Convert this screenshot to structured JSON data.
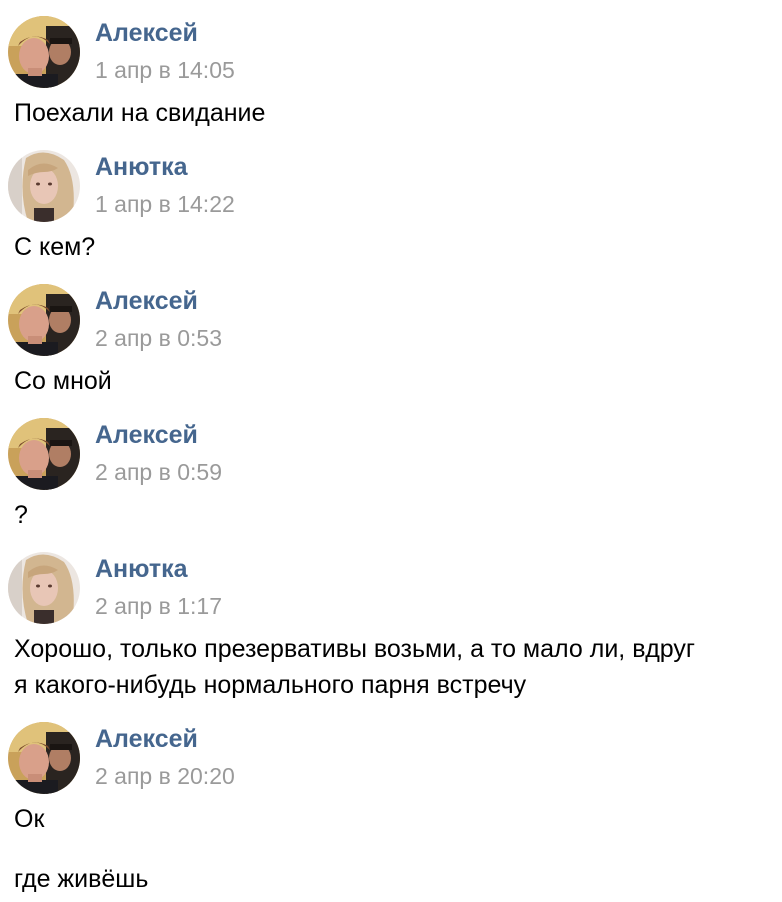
{
  "colors": {
    "author_link": "#45668e",
    "timestamp": "#9a9a9a",
    "message_text": "#000000",
    "background": "#ffffff"
  },
  "messages": [
    {
      "author": "Алексей",
      "avatar": "alexey-avatar",
      "time": "1 апр в 14:05",
      "lines": [
        "Поехали на свидание"
      ]
    },
    {
      "author": "Анютка",
      "avatar": "anyutka-avatar",
      "time": "1 апр в 14:22",
      "lines": [
        "С кем?"
      ]
    },
    {
      "author": "Алексей",
      "avatar": "alexey-avatar",
      "time": "2 апр в 0:53",
      "lines": [
        "Со мной"
      ]
    },
    {
      "author": "Алексей",
      "avatar": "alexey-avatar",
      "time": "2 апр в 0:59",
      "lines": [
        "?"
      ]
    },
    {
      "author": "Анютка",
      "avatar": "anyutka-avatar",
      "time": "2 апр в 1:17",
      "lines": [
        "Хорошо, только презервативы возьми, а то мало ли, вдруг",
        "я какого-нибудь нормального парня встречу"
      ]
    },
    {
      "author": "Алексей",
      "avatar": "alexey-avatar",
      "time": "2 апр в 20:20",
      "lines": [
        "Ок",
        "где живёшь"
      ]
    }
  ]
}
